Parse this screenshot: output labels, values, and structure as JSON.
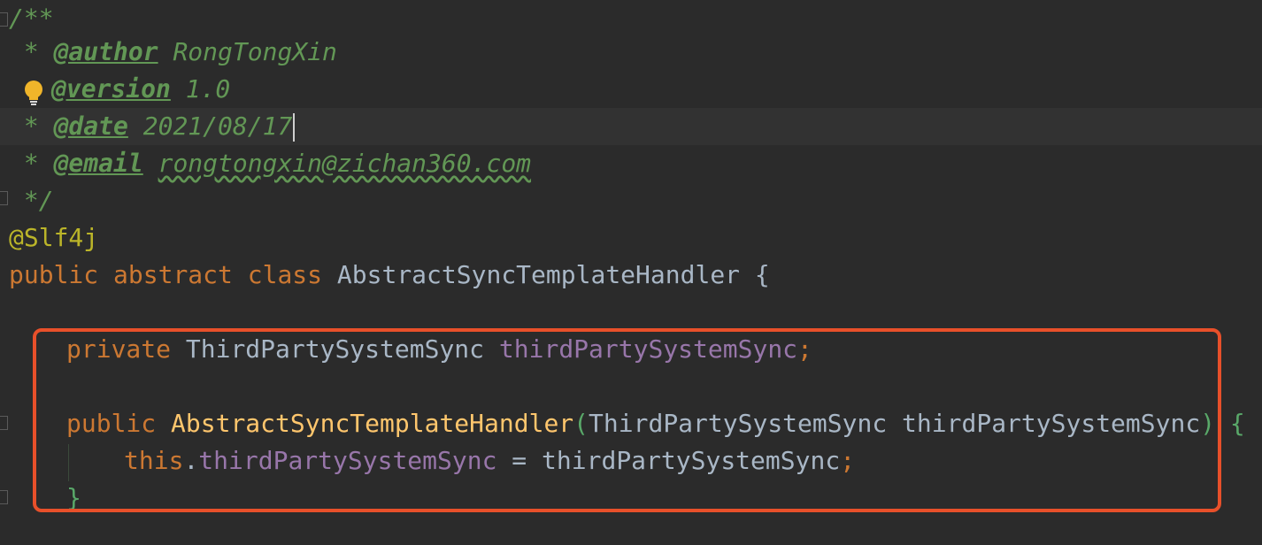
{
  "editor": {
    "lines": {
      "l1": {
        "text": "/**"
      },
      "l2": {
        "star": " * ",
        "tag": "@author",
        "value": " RongTongXin"
      },
      "l3": {
        "tag": "@version",
        "value": " 1.0"
      },
      "l4": {
        "star": " * ",
        "tag": "@date",
        "value": " 2021/08/17"
      },
      "l5": {
        "star": " * ",
        "tag": "@email",
        "space": " ",
        "value": "rongtongxin@zichan360.com"
      },
      "l6": {
        "text": " */"
      },
      "l7": {
        "text": "@Slf4j"
      },
      "l8": {
        "kw1": "public",
        "kw2": "abstract",
        "kw3": "class",
        "name": "AbstractSyncTemplateHandler",
        "brace": "{"
      },
      "l9": {
        "kw": "private",
        "type": "ThirdPartySystemSync",
        "field": "thirdPartySystemSync",
        "semi": ";"
      },
      "l10": {
        "kw": "public",
        "method": "AbstractSyncTemplateHandler",
        "open": "(",
        "ptype": "ThirdPartySystemSync",
        "pname": "thirdPartySystemSync",
        "close": ")",
        "brace": "{"
      },
      "l11": {
        "kw": "this",
        "dot": ".",
        "field": "thirdPartySystemSync",
        "assign": " = ",
        "value": "thirdPartySystemSync",
        "semi": ";"
      },
      "l12": {
        "brace": "}"
      }
    }
  },
  "icons": {
    "bulb": "lightbulb-icon"
  },
  "colors": {
    "background": "#2b2b2b",
    "doc_comment": "#629755",
    "keyword": "#cc7832",
    "annotation": "#bbb529",
    "field": "#9876aa",
    "method": "#ffc66d",
    "plain": "#a9b7c6",
    "highlight_border": "#e8502a"
  }
}
